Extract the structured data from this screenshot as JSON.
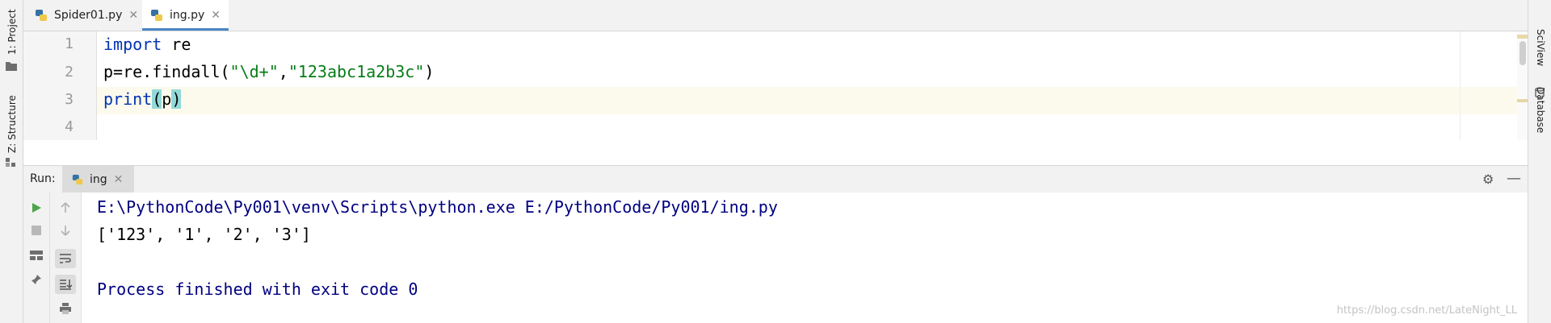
{
  "tool_windows": {
    "left": [
      {
        "label": "1: Project"
      },
      {
        "label": "Z: Structure"
      }
    ],
    "right": [
      {
        "label": "SciView"
      },
      {
        "label": "Database"
      }
    ]
  },
  "editor_tabs": [
    {
      "label": "Spider01.py",
      "active": false
    },
    {
      "label": "ing.py",
      "active": true
    }
  ],
  "editor": {
    "line_numbers": [
      "1",
      "2",
      "3",
      "4"
    ],
    "lines": {
      "l1": {
        "kw": "import",
        "rest": " re"
      },
      "l2": {
        "pre": "p=re.findall(",
        "s1": "\"\\d+\"",
        "comma": ",",
        "s2": "\"123abc1a2b3c\"",
        "post": ")"
      },
      "l3": {
        "fn": "print",
        "open": "(",
        "arg": "p",
        "close": ")"
      },
      "l4": {
        "text": ""
      }
    }
  },
  "run_panel": {
    "label": "Run:",
    "tab_label": "ing",
    "console": [
      "E:\\PythonCode\\Py001\\venv\\Scripts\\python.exe E:/PythonCode/Py001/ing.py",
      "['123', '1', '2', '3']",
      "",
      "Process finished with exit code 0"
    ]
  },
  "watermark": "https://blog.csdn.net/LateNight_LL",
  "colors": {
    "keyword": "#0033b3",
    "string": "#067d17",
    "console_text": "#000080",
    "active_tab_underline": "#4a87c7",
    "run_green": "#4ca64c"
  }
}
